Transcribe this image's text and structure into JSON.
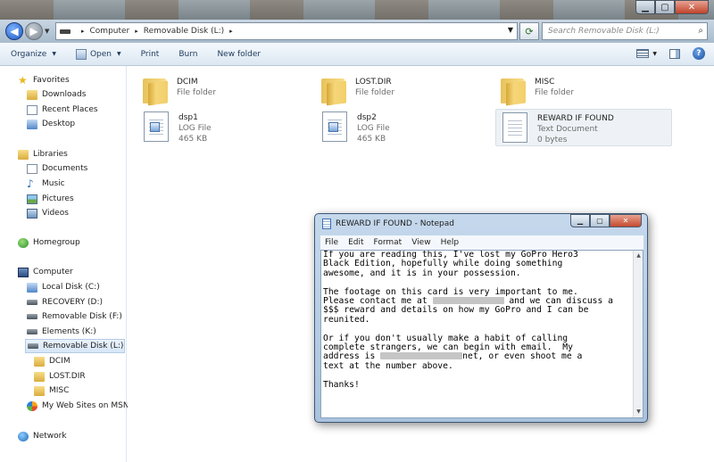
{
  "address": {
    "crumbs": [
      "Computer",
      "Removable Disk (L:)"
    ],
    "search_placeholder": "Search Removable Disk (L:)"
  },
  "toolbar": {
    "organize": "Organize",
    "open": "Open",
    "print": "Print",
    "burn": "Burn",
    "new_folder": "New folder"
  },
  "nav": {
    "favorites": "Favorites",
    "downloads": "Downloads",
    "recent_places": "Recent Places",
    "desktop": "Desktop",
    "libraries": "Libraries",
    "documents": "Documents",
    "music": "Music",
    "pictures": "Pictures",
    "videos": "Videos",
    "homegroup": "Homegroup",
    "computer": "Computer",
    "local_disk": "Local Disk (C:)",
    "recovery": "RECOVERY (D:)",
    "removable_f": "Removable Disk (F:)",
    "elements": "Elements (K:)",
    "removable_l": "Removable Disk (L:)",
    "dcim": "DCIM",
    "lost_dir": "LOST.DIR",
    "misc": "MISC",
    "web_sites": "My Web Sites on MSN",
    "network": "Network"
  },
  "files": [
    {
      "name": "DCIM",
      "type": "File folder",
      "size": ""
    },
    {
      "name": "LOST.DIR",
      "type": "File folder",
      "size": ""
    },
    {
      "name": "MISC",
      "type": "File folder",
      "size": ""
    },
    {
      "name": "dsp1",
      "type": "LOG File",
      "size": "465 KB"
    },
    {
      "name": "dsp2",
      "type": "LOG File",
      "size": "465 KB"
    },
    {
      "name": "REWARD IF FOUND",
      "type": "Text Document",
      "size": "0 bytes"
    }
  ],
  "notepad": {
    "title": "REWARD IF FOUND - Notepad",
    "menu": [
      "File",
      "Edit",
      "Format",
      "View",
      "Help"
    ],
    "lines": [
      "If you are reading this, I've lost my GoPro Hero3",
      "Black Edition, hopefully while doing something",
      "awesome, and it is in your possession.",
      "",
      "The footage on this card is very important to me.",
      "Please contact me at",
      " and we can discuss a",
      "$$$ reward and details on how my GoPro and I can be",
      "reunited.",
      "",
      "Or if you don't usually make a habit of calling",
      "complete strangers, we can begin with email.  My",
      "address is",
      "net, or even shoot me a",
      "text at the number above.",
      "",
      "Thanks!"
    ]
  }
}
